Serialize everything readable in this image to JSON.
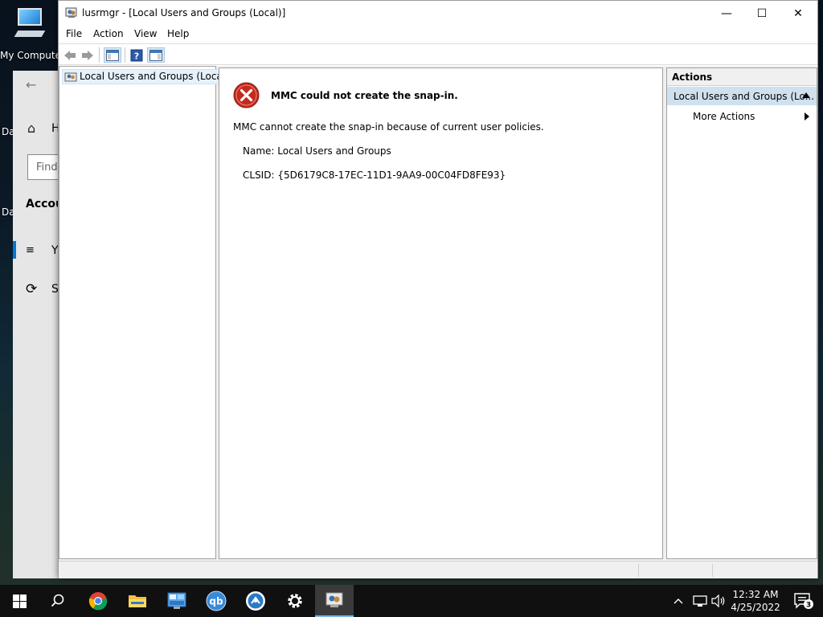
{
  "desktop": {
    "icon_label": "My Computer",
    "fragment_1": "Da",
    "fragment_2": "Da"
  },
  "settings_window": {
    "home_fragment": "H",
    "search_placeholder": "Find",
    "section_fragment": "Accou",
    "item_1_fragment": "Y",
    "item_2_fragment": "S"
  },
  "window": {
    "title": "lusrmgr - [Local Users and Groups (Local)]",
    "controls": {
      "minimize": "—",
      "maximize": "☐",
      "close": "✕"
    }
  },
  "menu": [
    "File",
    "Action",
    "View",
    "Help"
  ],
  "tree": {
    "root_label": "Local Users and Groups (Local)"
  },
  "error": {
    "title": "MMC could not create the snap-in.",
    "message": "MMC cannot create the snap-in because of current user policies.",
    "name_line": "Name: Local Users and Groups",
    "clsid_line": "CLSID: {5D6179C8-17EC-11D1-9AA9-00C04FD8FE93}"
  },
  "actions": {
    "header": "Actions",
    "section": "Local Users and Groups (Lo...",
    "items": [
      "More Actions"
    ]
  },
  "taskbar": {
    "apps": [
      "start",
      "search",
      "chrome",
      "file-explorer",
      "control-panel",
      "qbittorrent",
      "app",
      "settings",
      "mmc"
    ],
    "qb_label": "qb",
    "time": "12:32 AM",
    "date": "4/25/2022",
    "notification_count": "3"
  },
  "colors": {
    "accent": "#0078d7",
    "selection": "#cfe0ee",
    "error_red": "#c42b1c",
    "taskbar": "#101010"
  }
}
